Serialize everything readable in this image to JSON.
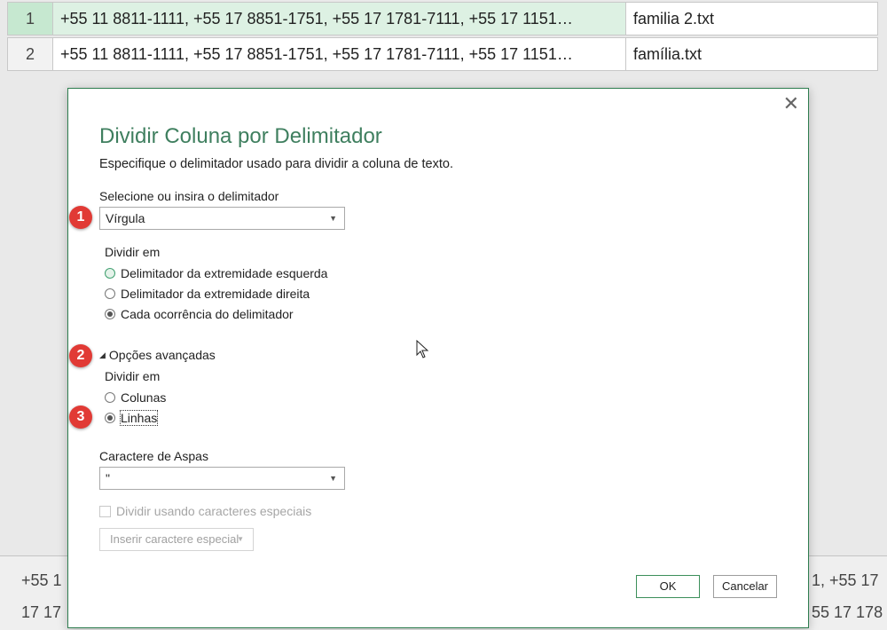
{
  "table": {
    "rows": [
      {
        "num": "1",
        "text": "+55 11 8811-1111, +55 17 8851-1751, +55 17 1781-7111, +55 17 1151…",
        "file": "familia 2.txt"
      },
      {
        "num": "2",
        "text": "+55 11 8811-1111, +55 17 8851-1751, +55 17 1781-7111, +55 17 1151…",
        "file": "família.txt"
      }
    ]
  },
  "preview": {
    "left_line1": "+55 1",
    "left_line2": "17 17",
    "right_line1": "1, +55 17",
    "right_line2": "55 17 178"
  },
  "dialog": {
    "close_icon": "close-icon",
    "title": "Dividir Coluna por Delimitador",
    "description": "Especifique o delimitador usado para dividir a coluna de texto.",
    "delimiter_label": "Selecione ou insira o delimitador",
    "delimiter_value": "Vírgula",
    "split_at_label": "Dividir em",
    "split_options": [
      {
        "label": "Delimitador da extremidade esquerda",
        "checked": false
      },
      {
        "label": "Delimitador da extremidade direita",
        "checked": false
      },
      {
        "label": "Cada ocorrência do delimitador",
        "checked": true
      }
    ],
    "advanced_label": "Opções avançadas",
    "split_into_label": "Dividir em",
    "split_into_options": [
      {
        "label": "Colunas",
        "checked": false
      },
      {
        "label": "Linhas",
        "checked": true
      }
    ],
    "quote_label": "Caractere de Aspas",
    "quote_value": "\"",
    "special_chars_label": "Dividir usando caracteres especiais",
    "insert_special_label": "Inserir caractere especial",
    "ok_label": "OK",
    "cancel_label": "Cancelar"
  },
  "badges": [
    "1",
    "2",
    "3"
  ],
  "colors": {
    "accent": "#3f7f5f",
    "badge": "#e13a35",
    "selected_row": "#ddf1e3"
  }
}
